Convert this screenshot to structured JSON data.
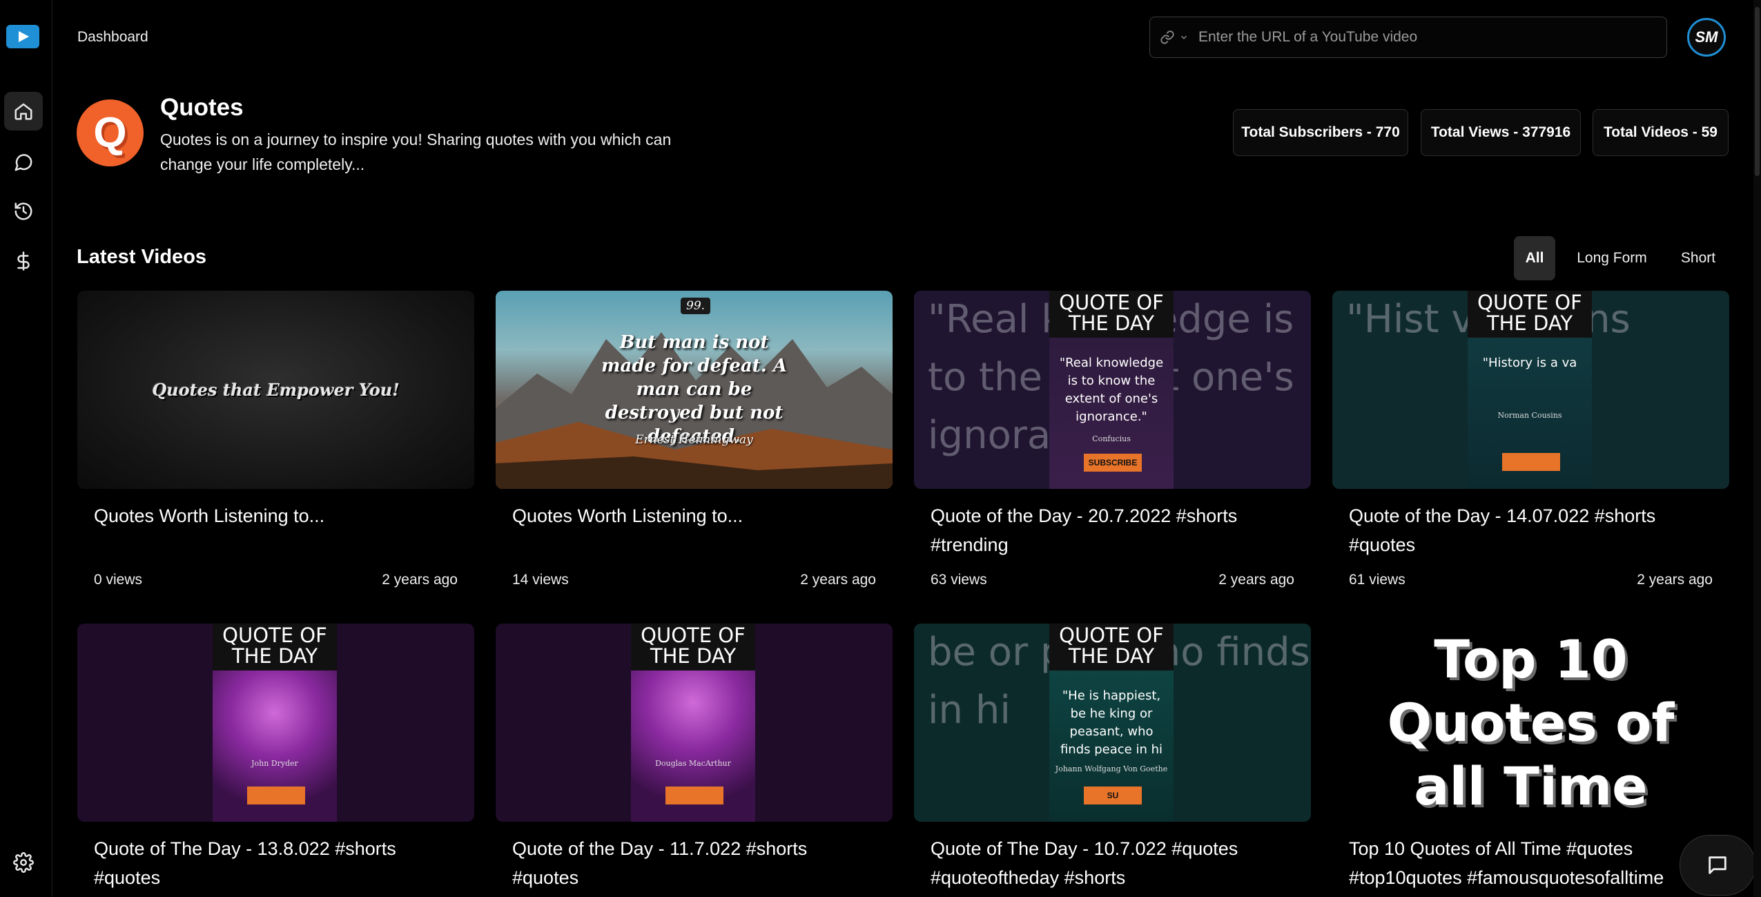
{
  "header": {
    "breadcrumb": "Dashboard",
    "url_placeholder": "Enter the URL of a YouTube video"
  },
  "sidebar": {
    "items": [
      {
        "icon": "home-icon",
        "active": true
      },
      {
        "icon": "chat-icon",
        "active": false
      },
      {
        "icon": "history-icon",
        "active": false
      },
      {
        "icon": "dollar-icon",
        "active": false
      }
    ],
    "footer_icon": "settings-icon"
  },
  "channel": {
    "initial": "Q",
    "name": "Quotes",
    "description": "Quotes is on a journey to inspire you! Sharing quotes with you which can change your life completely..."
  },
  "stats": [
    {
      "label": "Total Subscribers - 770"
    },
    {
      "label": "Total Views - 377916"
    },
    {
      "label": "Total Videos - 59"
    }
  ],
  "videos_section": {
    "title": "Latest Videos",
    "filters": [
      "All",
      "Long Form",
      "Short"
    ],
    "active_filter": "All"
  },
  "videos": [
    {
      "title": "Quotes Worth Listening to...",
      "views": "0 views",
      "age": "2 years ago",
      "thumb_text": "Quotes that Empower You!"
    },
    {
      "title": "Quotes Worth Listening to...",
      "views": "14 views",
      "age": "2 years ago",
      "thumb_num": "99.",
      "thumb_quote": "But man is not made for defeat. A man can be destroyed but not defeated.",
      "thumb_author": "Ernest Heimingway"
    },
    {
      "title": "Quote of the Day - 20.7.2022 #shorts #trending",
      "views": "63 views",
      "age": "2 years ago",
      "thumb_header": "QUOTE OF THE DAY",
      "thumb_bg": "\"Real knowledge is to the extent one's ignorance.\"",
      "thumb_quote": "\"Real knowledge is to know the extent of one's ignorance.\"",
      "thumb_author": "Confucius",
      "thumb_button": "SUBSCRIBE"
    },
    {
      "title": "Quote of the Day - 14.07.022 #shorts #quotes",
      "views": "61 views",
      "age": "2 years ago",
      "thumb_header": "QUOTE OF THE DAY",
      "thumb_bg": "\"Hist va No ins",
      "thumb_quote": "\"History is a va",
      "thumb_author": "Norman Cousins"
    },
    {
      "title": "Quote of The Day - 13.8.022 #shorts #quotes",
      "thumb_header": "QUOTE OF THE DAY",
      "thumb_author": "John Dryder"
    },
    {
      "title": "Quote of the Day - 11.7.022 #shorts #quotes",
      "thumb_header": "QUOTE OF THE DAY",
      "thumb_author": "Douglas MacArthur"
    },
    {
      "title": "Quote of The Day - 10.7.022 #quotes #quoteoftheday #shorts",
      "thumb_header": "QUOTE OF THE DAY",
      "thumb_bg": "be or pea who finds in hi",
      "thumb_quote": "\"He is happiest, be he king or peasant, who finds peace in hi",
      "thumb_author": "Johann Wolfgang Von Goethe",
      "thumb_button": "SU"
    },
    {
      "title": "Top 10 Quotes of All Time #quotes #top10quotes #famousquotesofalltime",
      "thumb_text": "Top 10 Quotes of all Time"
    }
  ],
  "colors": {
    "accent": "#1f8fd6",
    "channel_logo": "#f0622a",
    "background": "#000000"
  }
}
